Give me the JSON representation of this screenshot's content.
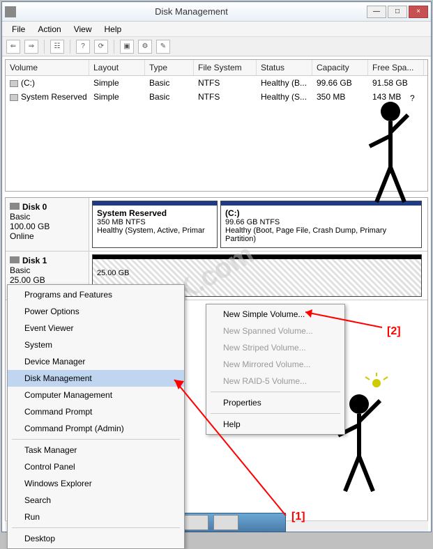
{
  "window": {
    "title": "Disk Management",
    "menu": [
      "File",
      "Action",
      "View",
      "Help"
    ]
  },
  "columns": [
    "Volume",
    "Layout",
    "Type",
    "File System",
    "Status",
    "Capacity",
    "Free Spa..."
  ],
  "volumes": [
    {
      "name": "(C:)",
      "layout": "Simple",
      "type": "Basic",
      "fs": "NTFS",
      "status": "Healthy (B...",
      "capacity": "99.66 GB",
      "free": "91.58 GB"
    },
    {
      "name": "System Reserved",
      "layout": "Simple",
      "type": "Basic",
      "fs": "NTFS",
      "status": "Healthy (S...",
      "capacity": "350 MB",
      "free": "143 MB"
    }
  ],
  "disks": [
    {
      "label": "Disk 0",
      "type": "Basic",
      "size": "100.00 GB",
      "status": "Online",
      "partitions": [
        {
          "title": "System Reserved",
          "sub1": "350 MB NTFS",
          "sub2": "Healthy (System, Active, Primar"
        },
        {
          "title": "(C:)",
          "sub1": "99.66 GB NTFS",
          "sub2": "Healthy (Boot, Page File, Crash Dump, Primary Partition)"
        }
      ]
    },
    {
      "label": "Disk 1",
      "type": "Basic",
      "size": "25.00 GB",
      "status": "",
      "partitions": [
        {
          "title": "",
          "sub1": "25.00 GB",
          "sub2": ""
        }
      ]
    }
  ],
  "winx_menu": [
    "Programs and Features",
    "Power Options",
    "Event Viewer",
    "System",
    "Device Manager",
    "Disk Management",
    "Computer Management",
    "Command Prompt",
    "Command Prompt (Admin)",
    "Task Manager",
    "Control Panel",
    "Windows Explorer",
    "Search",
    "Run",
    "Desktop"
  ],
  "context_menu": {
    "new_simple": "New Simple Volume...",
    "new_spanned": "New Spanned Volume...",
    "new_striped": "New Striped Volume...",
    "new_mirrored": "New Mirrored Volume...",
    "new_raid5": "New RAID-5 Volume...",
    "properties": "Properties",
    "help": "Help"
  },
  "annotations": {
    "one": "[1]",
    "two": "[2]"
  },
  "watermark": "SoftwareOK.com"
}
